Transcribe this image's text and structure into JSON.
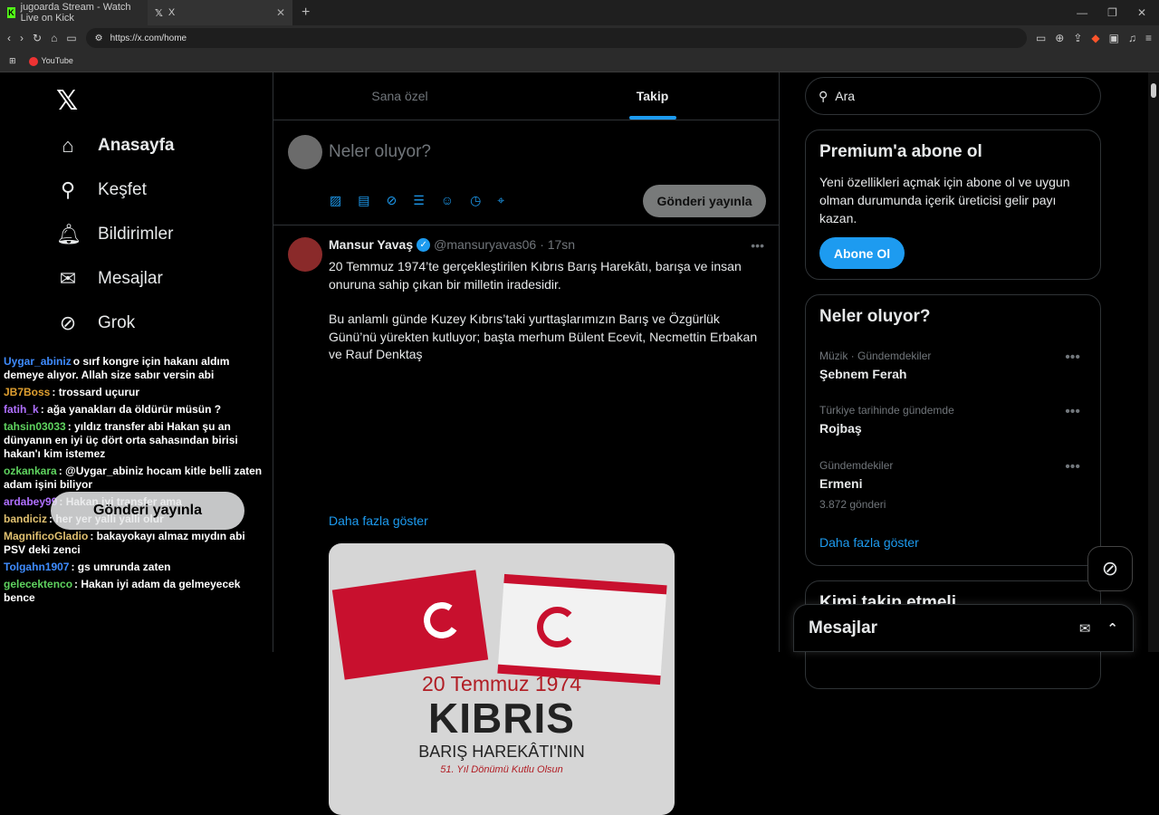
{
  "browser": {
    "tabs": [
      {
        "label": "jugoarda Stream - Watch Live on Kick"
      },
      {
        "label": "X"
      }
    ],
    "url": "https://x.com/home",
    "bookmarks": [
      {
        "label": "YouTube"
      }
    ]
  },
  "nav": {
    "items": [
      {
        "label": "Anasayfa"
      },
      {
        "label": "Keşfet"
      },
      {
        "label": "Bildirimler"
      },
      {
        "label": "Mesajlar"
      },
      {
        "label": "Grok"
      }
    ],
    "post_button": "Gönderi yayınla"
  },
  "chat": [
    {
      "user": "Uygar_abiniz",
      "color": "#3f8cff",
      "text": "o sırf kongre için hakanı aldım demeye alıyor. Allah size sabır versin abi"
    },
    {
      "user": "JB7Boss",
      "color": "#e0a030",
      "text": ": trossard uçurur"
    },
    {
      "user": "fatih_k",
      "color": "#b070ff",
      "text": ": ağa yanakları da öldürür müsün ?"
    },
    {
      "user": "tahsin03033",
      "color": "#5fd35f",
      "text": ": yıldız transfer abi Hakan şu an dünyanın en iyi üç dört orta sahasından birisi hakan'ı kim istemez"
    },
    {
      "user": "ozkankara",
      "color": "#5fd35f",
      "text": ": @Uygar_abiniz hocam kitle belli zaten adam işini biliyor"
    },
    {
      "user": "ardabey99",
      "color": "#b070ff",
      "text": ": Hakan iyi transfer ama"
    },
    {
      "user": "bandiciz",
      "color": "#e0c070",
      "text": ": her yer yalli yalli olur"
    },
    {
      "user": "MagnificoGladio",
      "color": "#e0c070",
      "text": ": bakayokayı almaz mıydın abi PSV deki zenci"
    },
    {
      "user": "Tolgahn1907",
      "color": "#3f8cff",
      "text": ": gs umrunda zaten"
    },
    {
      "user": "gelecektenco",
      "color": "#5fd35f",
      "text": ": Hakan iyi adam da gelmeyecek bence"
    }
  ],
  "main": {
    "tabs": [
      {
        "label": "Sana özel"
      },
      {
        "label": "Takip"
      }
    ],
    "compose": {
      "placeholder": "Neler oluyor?",
      "post_button": "Gönderi yayınla"
    },
    "tweet": {
      "name": "Mansur Yavaş",
      "handle": "@mansuryavas06",
      "time": "· 17sn",
      "para1": "20 Temmuz 1974’te gerçekleştirilen Kıbrıs Barış Harekâtı, barışa ve insan onuruna sahip çıkan bir milletin iradesidir.",
      "para2": "Bu anlamlı günde Kuzey Kıbrıs’taki yurttaşlarımızın Barış ve Özgürlük Günü’nü yürekten kutluyor; başta merhum Bülent Ecevit, Necmettin Erbakan ve Rauf Denktaş",
      "show_more": "Daha fazla göster",
      "media": {
        "line1": "20 Temmuz 1974",
        "line2": "KIBRIS",
        "line3": "BARIŞ HAREKÂTI'NIN",
        "line4": "51. Yıl Dönümü Kutlu Olsun"
      }
    }
  },
  "right": {
    "search_placeholder": "Ara",
    "premium": {
      "title": "Premium'a abone ol",
      "desc": "Yeni özellikleri açmak için abone ol ve uygun olman durumunda içerik üreticisi gelir payı kazan.",
      "button": "Abone Ol"
    },
    "trends": {
      "title": "Neler oluyor?",
      "items": [
        {
          "category": "Müzik · Gündemdekiler",
          "title": "Şebnem Ferah",
          "count": ""
        },
        {
          "category": "Türkiye tarihinde gündemde",
          "title": "Rojbaş",
          "count": ""
        },
        {
          "category": "Gündemdekiler",
          "title": "Ermeni",
          "count": "3.872 gönderi"
        }
      ],
      "show_more": "Daha fazla göster"
    },
    "follow_title": "Kimi takip etmeli",
    "messages_title": "Mesajlar"
  }
}
